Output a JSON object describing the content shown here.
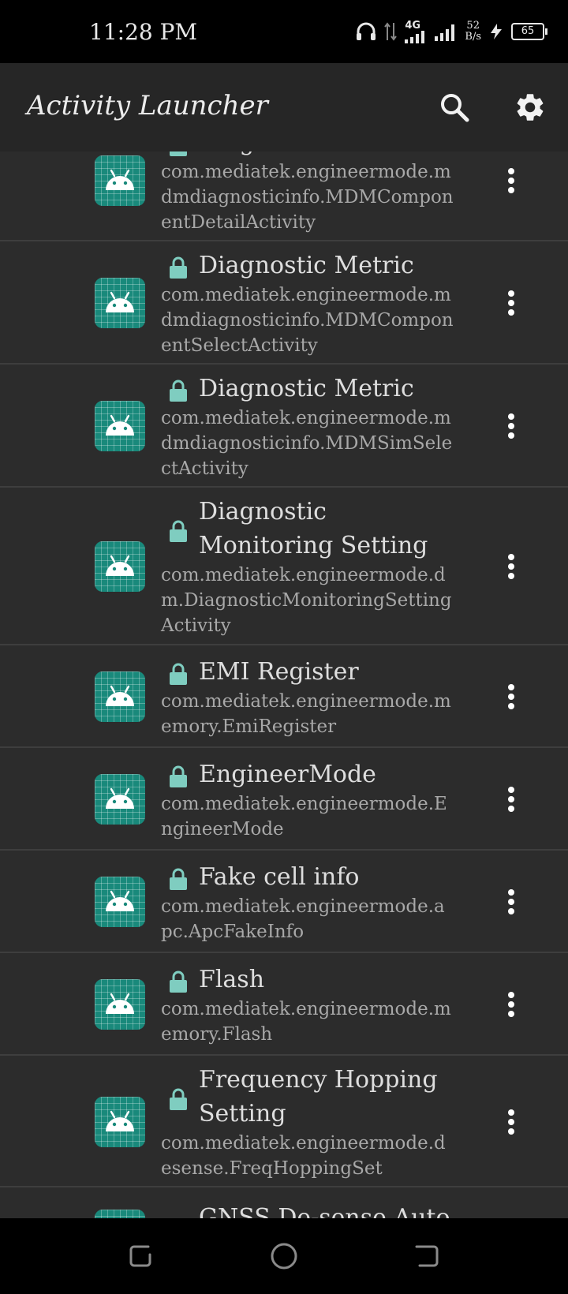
{
  "status_bar": {
    "time": "11:28 PM",
    "network": "4G",
    "speed_value": "52",
    "speed_unit": "B/s",
    "battery": "65"
  },
  "app_bar": {
    "title": "Activity Launcher",
    "search_icon": "search-icon",
    "settings_icon": "gear-icon"
  },
  "colors": {
    "icon_bg": "#19897b",
    "lock": "#7fcdc0",
    "background": "#2c2c2c"
  },
  "activities": [
    {
      "title": "Diagnostic Metric",
      "package": "com.mediatek.engineermode.mdmdiagnosticinfo.MDMComponentDetailActivity"
    },
    {
      "title": "Diagnostic Metric",
      "package": "com.mediatek.engineermode.mdmdiagnosticinfo.MDMComponentSelectActivity"
    },
    {
      "title": "Diagnostic Metric",
      "package": "com.mediatek.engineermode.mdmdiagnosticinfo.MDMSimSelectActivity"
    },
    {
      "title": "Diagnostic Monitoring Setting",
      "package": "com.mediatek.engineermode.dm.DiagnosticMonitoringSettingActivity"
    },
    {
      "title": "EMI Register",
      "package": "com.mediatek.engineermode.memory.EmiRegister"
    },
    {
      "title": "EngineerMode",
      "package": "com.mediatek.engineermode.EngineerMode"
    },
    {
      "title": "Fake cell info",
      "package": "com.mediatek.engineermode.apc.ApcFakeInfo"
    },
    {
      "title": "Flash",
      "package": "com.mediatek.engineermode.memory.Flash"
    },
    {
      "title": "Frequency Hopping Setting",
      "package": "com.mediatek.engineermode.desense.FreqHoppingSet"
    },
    {
      "title": "GNSS De-sense Auto",
      "package": ""
    }
  ]
}
